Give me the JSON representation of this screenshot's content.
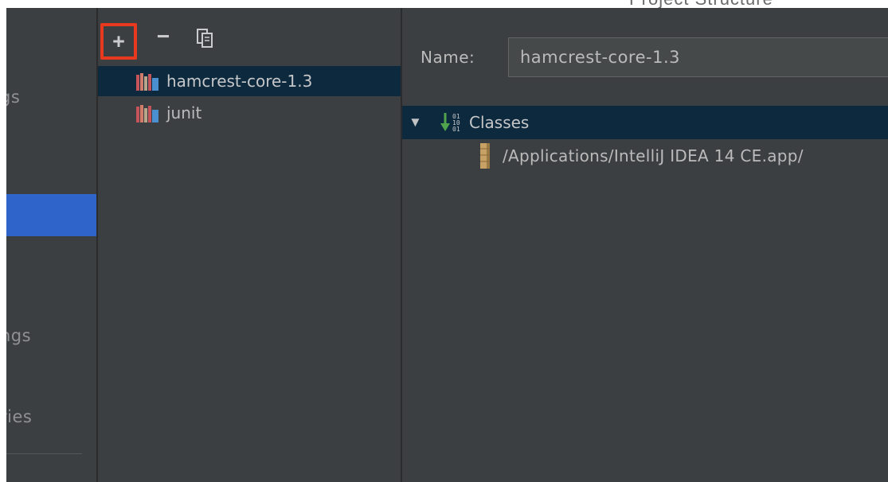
{
  "window": {
    "title": "Project Structure"
  },
  "nav": {
    "items": [
      {
        "label": "gs"
      },
      {
        "label": "ngs"
      },
      {
        "label": "ries"
      }
    ]
  },
  "toolbar": {
    "add_label": "+",
    "remove_label": "−",
    "add_icon": "plus-icon",
    "remove_icon": "minus-icon",
    "copy_icon": "copy-icon"
  },
  "libraries": {
    "items": [
      {
        "label": "hamcrest-core-1.3",
        "icon": "library-icon",
        "selected": true
      },
      {
        "label": "junit",
        "icon": "library-icon",
        "selected": false
      }
    ]
  },
  "details": {
    "name_label": "Name:",
    "name_value": "hamcrest-core-1.3",
    "tree": {
      "root_label": "Classes",
      "root_icon": "classes-icon",
      "root_expanded": true,
      "children": [
        {
          "label": "/Applications/IntelliJ IDEA 14 CE.app/",
          "icon": "jar-icon"
        }
      ]
    }
  },
  "colors": {
    "panel_bg": "#3c3f41",
    "selection_bg": "#0d293e",
    "nav_selected_bg": "#2f65ca",
    "highlight_border": "#e8391e",
    "text": "#bbbbbb"
  }
}
